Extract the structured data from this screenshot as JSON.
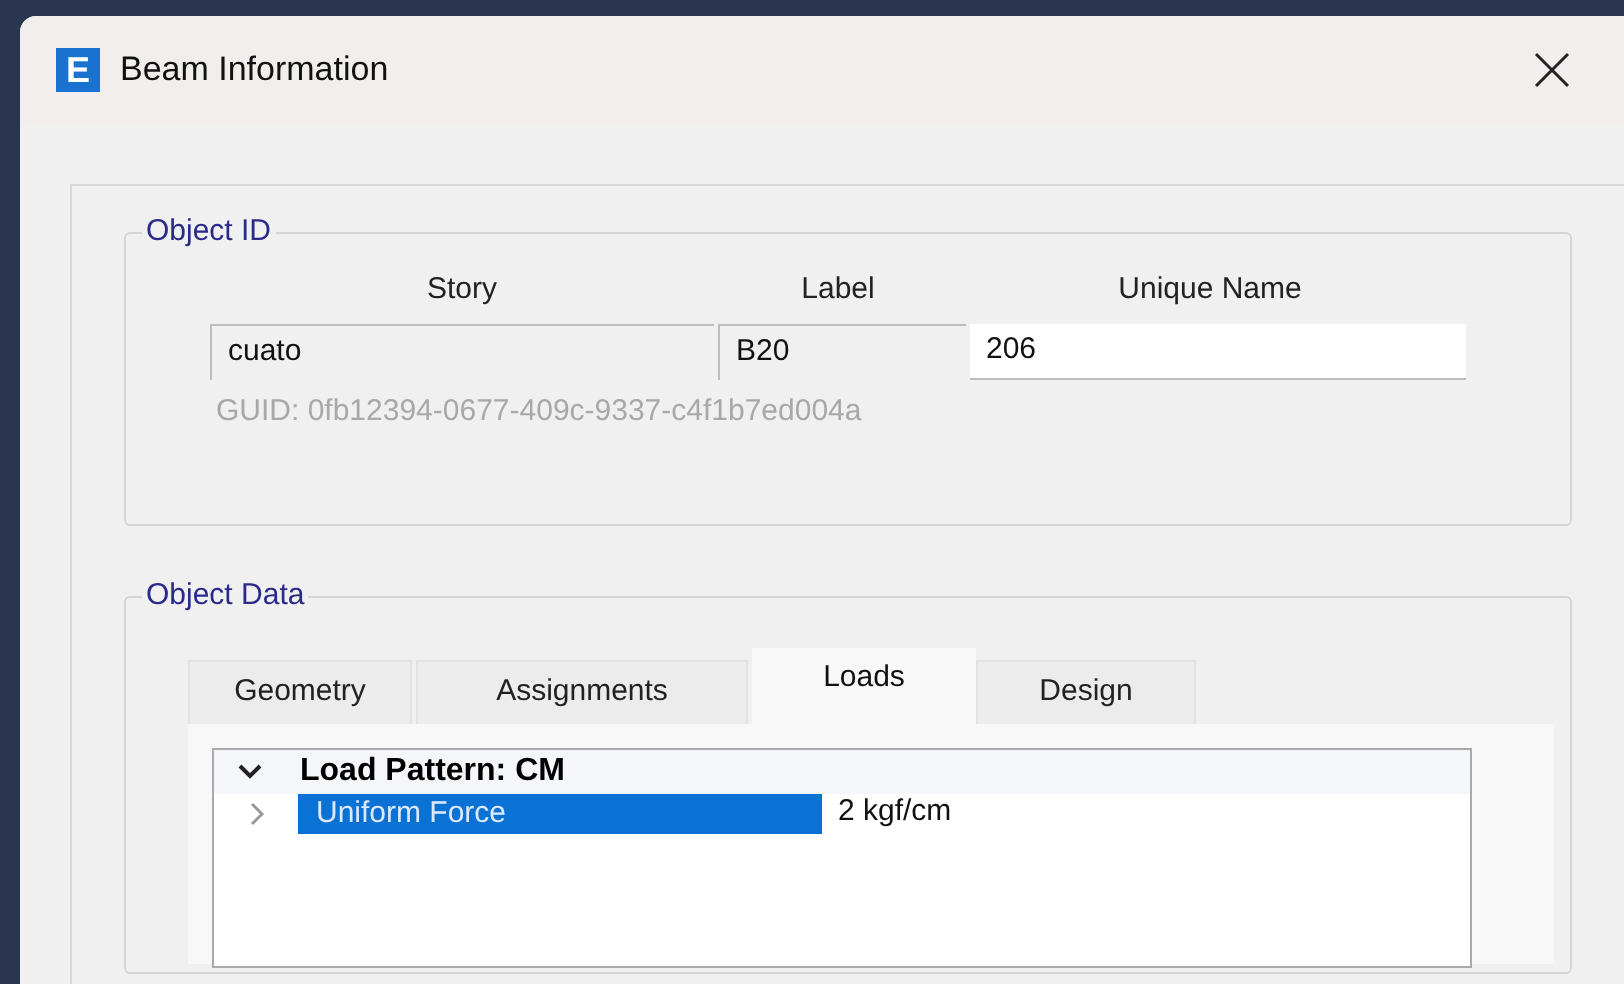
{
  "window": {
    "title": "Beam Information",
    "app_letter": "E"
  },
  "object_id": {
    "title": "Object ID",
    "columns": [
      "Story",
      "Label",
      "Unique Name"
    ],
    "fields": [
      {
        "value": "cuato",
        "editable": false
      },
      {
        "value": "B20",
        "editable": false
      },
      {
        "value": "206",
        "editable": true
      }
    ],
    "guid": "GUID:  0fb12394-0677-409c-9337-c4f1b7ed004a"
  },
  "object_data": {
    "title": "Object Data",
    "tabs": [
      {
        "label": "Geometry",
        "selected": false
      },
      {
        "label": "Assignments",
        "selected": false
      },
      {
        "label": "Loads",
        "selected": true
      },
      {
        "label": "Design",
        "selected": false
      }
    ],
    "tree": [
      {
        "label": "Load Pattern: CM",
        "expanded": true,
        "children": [
          {
            "label": "Uniform Force",
            "value": "2 kgf/cm",
            "expanded": false,
            "selected": true
          }
        ]
      }
    ]
  }
}
